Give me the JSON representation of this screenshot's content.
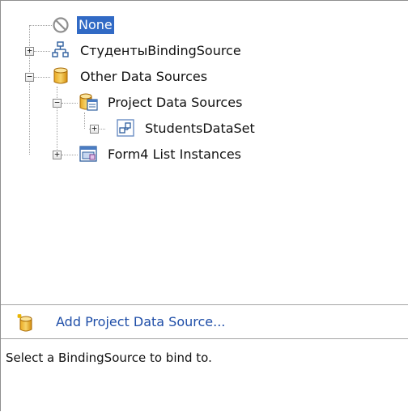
{
  "tree": {
    "nodes": [
      {
        "label": "None",
        "icon": "none-icon",
        "selected": true
      },
      {
        "label": "СтудентыBindingSource",
        "icon": "binding-source-icon",
        "expander": "+"
      },
      {
        "label": "Other Data Sources",
        "icon": "database-icon",
        "expander": "−"
      },
      {
        "label": "Project Data Sources",
        "icon": "project-data-sources-icon",
        "expander": "−"
      },
      {
        "label": "StudentsDataSet",
        "icon": "dataset-icon",
        "expander": "+"
      },
      {
        "label": "Form4 List Instances",
        "icon": "list-instances-icon",
        "expander": "+"
      }
    ]
  },
  "action": {
    "label": "Add Project Data Source...",
    "icon": "add-data-source-icon"
  },
  "status": {
    "text": "Select a BindingSource to bind to."
  },
  "colors": {
    "selection": "#316ac5",
    "link": "#1f4ea8",
    "border": "#a5a5a5"
  }
}
